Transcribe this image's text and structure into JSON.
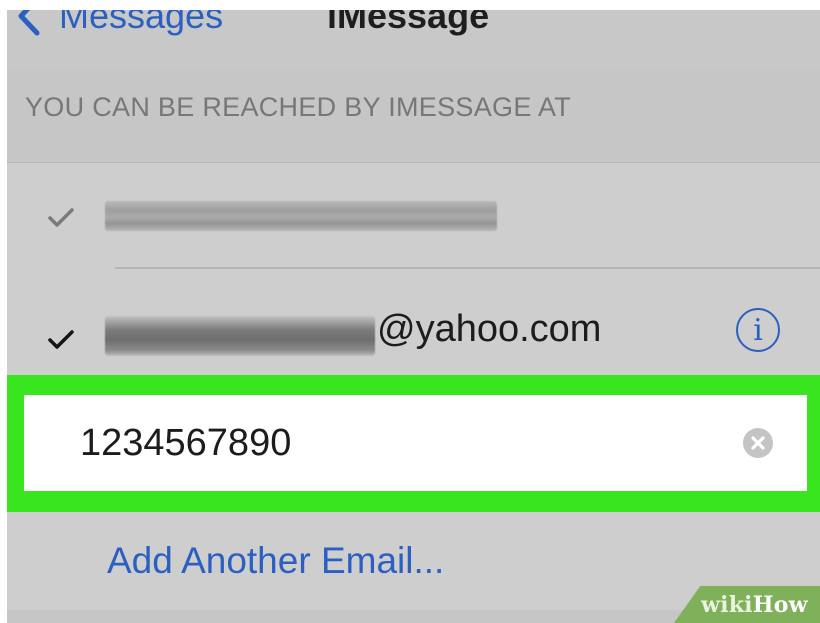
{
  "nav": {
    "back_label": "Messages",
    "title": "iMessage"
  },
  "section": {
    "header": "YOU CAN BE REACHED BY IMESSAGE AT"
  },
  "addresses": [
    {
      "checked": true,
      "value_redacted": true
    },
    {
      "checked": true,
      "email_suffix": "@yahoo.com"
    }
  ],
  "phone_field": {
    "value": "1234567890"
  },
  "add_link": {
    "label": "Add Another Email..."
  },
  "watermark": {
    "part1": "wiki",
    "part2": "How"
  },
  "colors": {
    "accent": "#2b5fc2",
    "highlight": "#39e51f",
    "background": "#cecece"
  },
  "icons": [
    "chevron-left-icon",
    "checkmark-icon",
    "info-icon",
    "clear-icon"
  ]
}
